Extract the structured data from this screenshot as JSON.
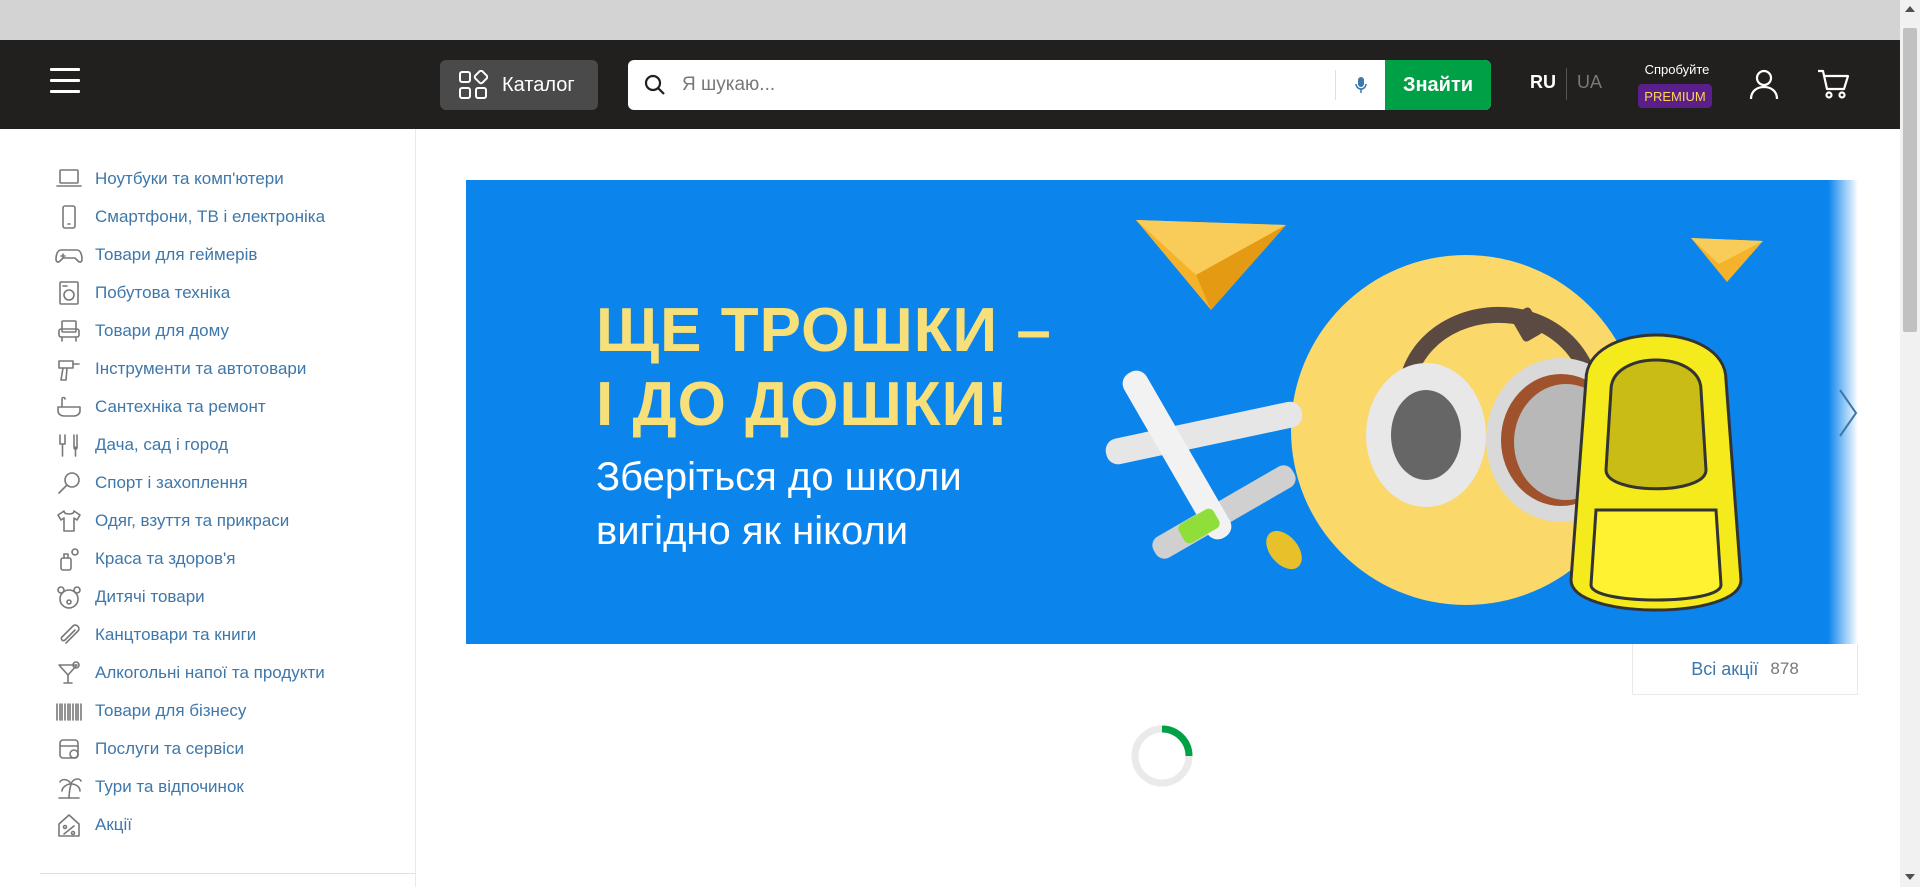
{
  "header": {
    "catalog_label": "Каталог",
    "search": {
      "placeholder": "Я шукаю...",
      "button_label": "Знайти"
    },
    "lang": {
      "active": "RU",
      "inactive": "UA"
    },
    "premium": {
      "try_label": "Спробуйте",
      "badge_label": "PREMIUM"
    },
    "icons": [
      "burger-menu-icon",
      "catalog-grid-icon",
      "search-icon",
      "microphone-icon",
      "user-icon",
      "cart-icon"
    ]
  },
  "sidebar": {
    "items": [
      {
        "label": "Ноутбуки та комп'ютери",
        "icon": "laptop-icon"
      },
      {
        "label": "Смартфони, ТВ і електроніка",
        "icon": "smartphone-icon"
      },
      {
        "label": "Товари для геймерів",
        "icon": "gamepad-icon"
      },
      {
        "label": "Побутова техніка",
        "icon": "washing-machine-icon"
      },
      {
        "label": "Товари для дому",
        "icon": "armchair-icon"
      },
      {
        "label": "Інструменти та автотовари",
        "icon": "drill-icon"
      },
      {
        "label": "Сантехніка та ремонт",
        "icon": "bathtub-icon"
      },
      {
        "label": "Дача, сад і город",
        "icon": "garden-fork-icon"
      },
      {
        "label": "Спорт і захоплення",
        "icon": "racket-icon"
      },
      {
        "label": "Одяг, взуття та прикраси",
        "icon": "tshirt-icon"
      },
      {
        "label": "Краса та здоров'я",
        "icon": "cosmetics-icon"
      },
      {
        "label": "Дитячі товари",
        "icon": "teddy-bear-icon"
      },
      {
        "label": "Канцтовари та книги",
        "icon": "paperclip-icon"
      },
      {
        "label": "Алкогольні напої та продукти",
        "icon": "cocktail-icon"
      },
      {
        "label": "Товари для бізнесу",
        "icon": "barcode-icon"
      },
      {
        "label": "Послуги та сервіси",
        "icon": "services-icon"
      },
      {
        "label": "Тури та відпочинок",
        "icon": "palm-tree-icon"
      },
      {
        "label": "Акції",
        "icon": "discount-tag-icon"
      }
    ]
  },
  "banner": {
    "headline_line1": "ЩЕ ТРОШКИ –",
    "headline_line2": "І ДО ДОШКИ!",
    "sub_line1": "Зберіться до школи",
    "sub_line2": "вигідно як ніколи",
    "background": "#0b84ec",
    "headline_color": "#f7e07a"
  },
  "promos": {
    "label": "Всі акції",
    "count": "878"
  },
  "colors": {
    "accent_green": "#00a046",
    "link_blue": "#3e77aa",
    "header_bg": "#221f1f"
  }
}
